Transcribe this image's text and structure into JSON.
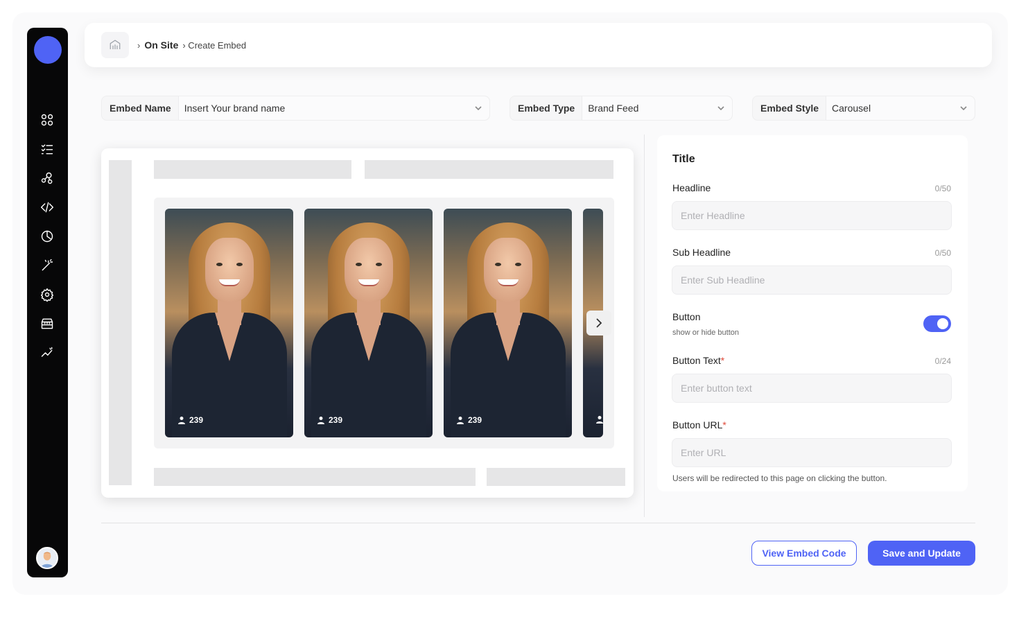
{
  "breadcrumb": {
    "separator": "›",
    "section": "On Site",
    "page": "› Create Embed"
  },
  "fields": {
    "embed_name": {
      "label": "Embed Name",
      "value": "Insert Your brand name"
    },
    "embed_type": {
      "label": "Embed Type",
      "value": "Brand Feed"
    },
    "embed_style": {
      "label": "Embed Style",
      "value": "Carousel"
    }
  },
  "carousel": {
    "cards": [
      {
        "count": "239"
      },
      {
        "count": "239"
      },
      {
        "count": "239"
      }
    ]
  },
  "form": {
    "title": "Title",
    "headline": {
      "label": "Headline",
      "counter": "0/50",
      "placeholder": "Enter Headline"
    },
    "sub_headline": {
      "label": "Sub Headline",
      "counter": "0/50",
      "placeholder": "Enter Sub Headline"
    },
    "button": {
      "label": "Button",
      "hint": "show or hide button",
      "enabled": true
    },
    "button_text": {
      "label": "Button Text",
      "required": "*",
      "counter": "0/24",
      "placeholder": "Enter button text"
    },
    "button_url": {
      "label": "Button URL",
      "required": "*",
      "placeholder": "Enter URL"
    },
    "note": "Users will be redirected to this page on clicking the button."
  },
  "actions": {
    "view_code": "View Embed Code",
    "save": "Save and Update"
  },
  "colors": {
    "accent": "#4f63f5",
    "sidebar": "#070708",
    "required": "#e04a3a"
  }
}
